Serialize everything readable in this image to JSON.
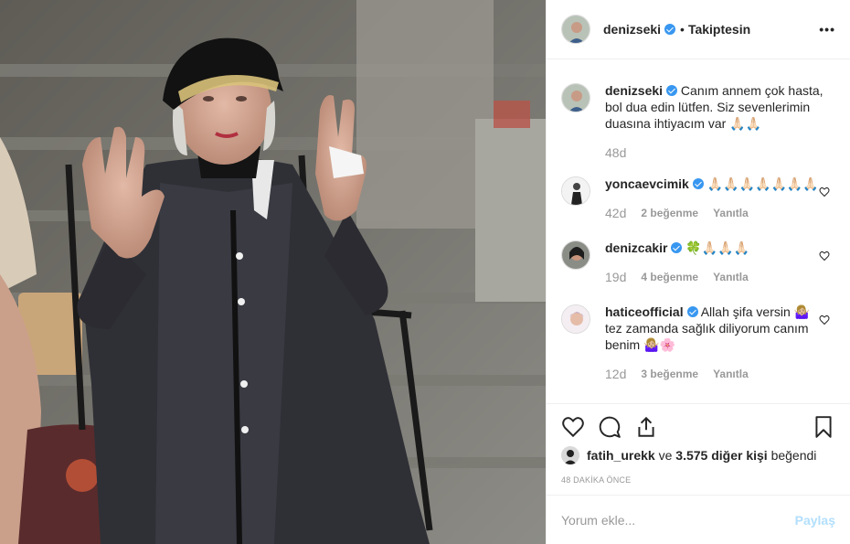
{
  "post": {
    "photo_subject": "elderly-woman-wheelchair-photo"
  },
  "header": {
    "username": "denizseki",
    "separator": "•",
    "follow_status": "Takiptesin",
    "more_label": "•••"
  },
  "caption": {
    "username": "denizseki",
    "text": "Canım annem çok hasta, bol dua edin lütfen. Siz sevenlerimin duasına ihtiyacım var 🙏🏻🙏🏻",
    "time": "48d"
  },
  "comments": [
    {
      "username": "yoncaevcimik",
      "text": "🙏🏻🙏🏻🙏🏻🙏🏻🙏🏻🙏🏻🙏🏻",
      "time": "42d",
      "likes": "2 beğenme",
      "reply": "Yanıtla"
    },
    {
      "username": "denizcakir",
      "prefix": "🍀",
      "text": "🙏🏻🙏🏻🙏🏻",
      "time": "19d",
      "likes": "4 beğenme",
      "reply": "Yanıtla"
    },
    {
      "username": "haticeofficial",
      "text": "Allah şifa versin 🤷🏼‍♀️ tez zamanda sağlık diliyorum canım benim 🤷🏼‍♀️🌸",
      "time": "12d",
      "likes": "3 beğenme",
      "reply": "Yanıtla"
    }
  ],
  "likes_summary": {
    "user": "fatih_urekk",
    "conj": "ve",
    "others": "3.575 diğer kişi",
    "suffix": "beğendi"
  },
  "timestamp": "48 DAKİKA ÖNCE",
  "comment_box": {
    "placeholder": "Yorum ekle...",
    "post_label": "Paylaş"
  },
  "colors": {
    "verified": "#3897f0",
    "post_button": "#b2dffc",
    "muted": "#999999"
  }
}
